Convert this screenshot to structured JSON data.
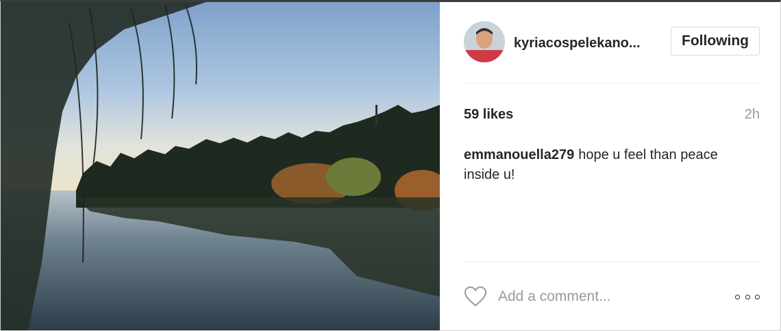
{
  "post": {
    "username": "kyriacospelekano...",
    "follow_label": "Following",
    "likes": "59 likes",
    "time": "2h",
    "comments": [
      {
        "author": "emmanouella279",
        "text": "hope u feel than peace inside u!"
      }
    ],
    "add_comment_placeholder": "Add a comment...",
    "icons": {
      "like": "heart-icon",
      "more": "more-options-icon"
    }
  },
  "colors": {
    "text": "#262626",
    "muted": "#999999",
    "divider": "#efefef",
    "button_border": "#dbdbdb"
  }
}
